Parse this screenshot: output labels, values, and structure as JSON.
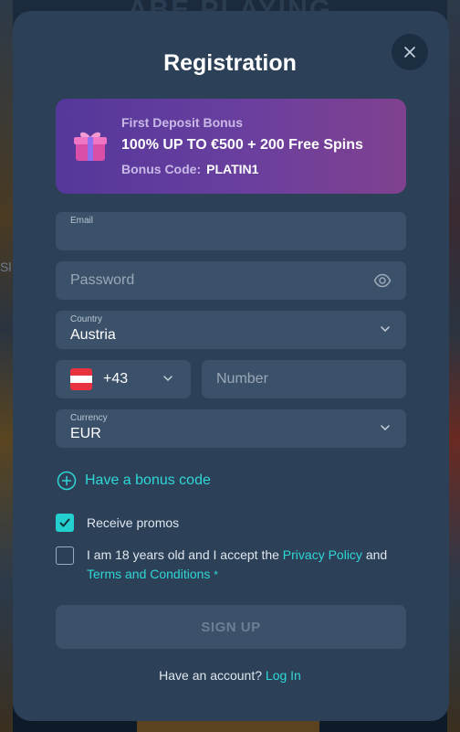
{
  "background": {
    "title": "ABE PLAYING",
    "side_text": "Sl"
  },
  "modal": {
    "title": "Registration",
    "close_icon": "close-icon"
  },
  "bonus": {
    "label": "First Deposit Bonus",
    "headline": "100% UP TO €500 + 200 Free Spins",
    "code_label": "Bonus Code:",
    "code": "PLATIN1",
    "icon": "gift-icon"
  },
  "form": {
    "email": {
      "label": "Email",
      "value": ""
    },
    "password": {
      "placeholder": "Password",
      "icon": "eye-icon"
    },
    "country": {
      "label": "Country",
      "value": "Austria"
    },
    "phone": {
      "flag": "austria-flag-icon",
      "code": "+43",
      "number_placeholder": "Number"
    },
    "currency": {
      "label": "Currency",
      "value": "EUR"
    }
  },
  "bonus_code_link": "Have a bonus code",
  "checkboxes": {
    "promos": {
      "label": "Receive promos",
      "checked": true
    },
    "terms": {
      "checked": false,
      "text_before": "I am 18 years old and I accept the ",
      "privacy_link": "Privacy Policy",
      "text_and": " and",
      "terms_link": "Terms and Conditions",
      "required_mark": "*"
    }
  },
  "signup_button": "SIGN UP",
  "login": {
    "text": "Have an account?",
    "link": "Log In"
  },
  "colors": {
    "accent": "#2fd6d6",
    "modal_bg": "#2c4158",
    "field_bg": "#3b5169"
  }
}
